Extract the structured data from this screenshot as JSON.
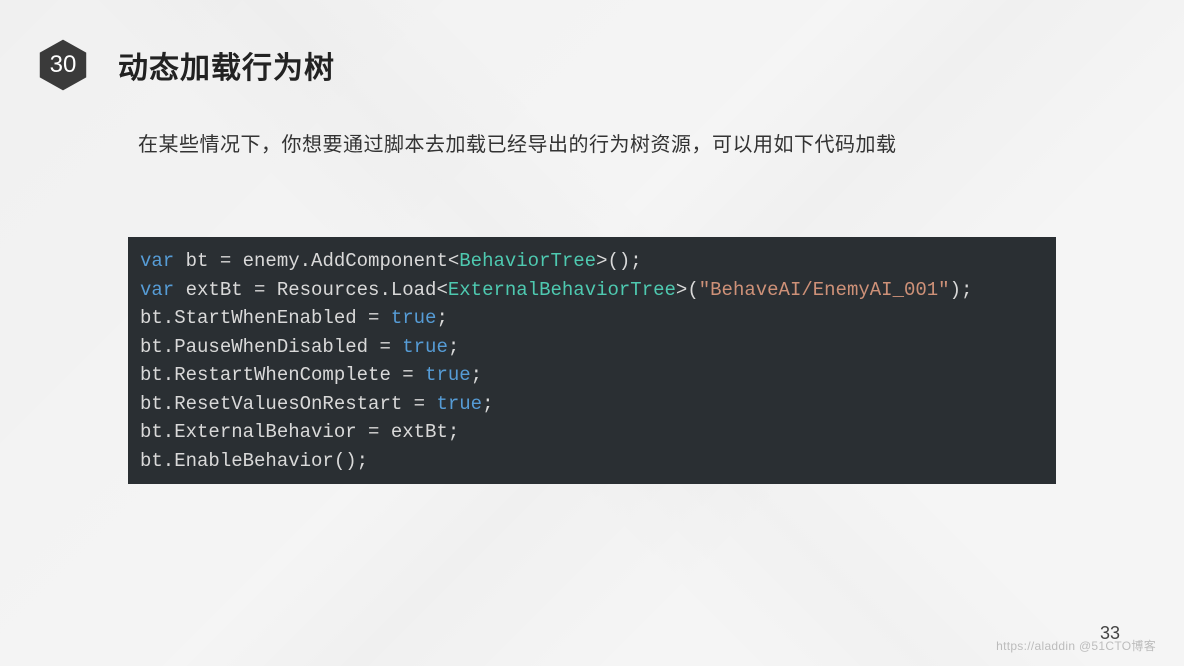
{
  "slide": {
    "number": "30",
    "title": "动态加载行为树",
    "description": "在某些情况下，你想要通过脚本去加载已经导出的行为树资源，可以用如下代码加载",
    "page_number": "33"
  },
  "code": {
    "lines": [
      {
        "tokens": [
          {
            "t": "kw",
            "v": "var"
          },
          {
            "t": "",
            "v": " bt = enemy.AddComponent<"
          },
          {
            "t": "type",
            "v": "BehaviorTree"
          },
          {
            "t": "",
            "v": ">();"
          }
        ]
      },
      {
        "tokens": [
          {
            "t": "kw",
            "v": "var"
          },
          {
            "t": "",
            "v": " extBt = Resources.Load<"
          },
          {
            "t": "type",
            "v": "ExternalBehaviorTree"
          },
          {
            "t": "",
            "v": ">("
          },
          {
            "t": "str",
            "v": "\"BehaveAI/EnemyAI_001\""
          },
          {
            "t": "",
            "v": ");"
          }
        ]
      },
      {
        "tokens": [
          {
            "t": "",
            "v": "bt.StartWhenEnabled = "
          },
          {
            "t": "kw",
            "v": "true"
          },
          {
            "t": "",
            "v": ";"
          }
        ]
      },
      {
        "tokens": [
          {
            "t": "",
            "v": "bt.PauseWhenDisabled = "
          },
          {
            "t": "kw",
            "v": "true"
          },
          {
            "t": "",
            "v": ";"
          }
        ]
      },
      {
        "tokens": [
          {
            "t": "",
            "v": "bt.RestartWhenComplete = "
          },
          {
            "t": "kw",
            "v": "true"
          },
          {
            "t": "",
            "v": ";"
          }
        ]
      },
      {
        "tokens": [
          {
            "t": "",
            "v": "bt.ResetValuesOnRestart = "
          },
          {
            "t": "kw",
            "v": "true"
          },
          {
            "t": "",
            "v": ";"
          }
        ]
      },
      {
        "tokens": [
          {
            "t": "",
            "v": "bt.ExternalBehavior = extBt;"
          }
        ]
      },
      {
        "tokens": [
          {
            "t": "",
            "v": "bt.EnableBehavior();"
          }
        ]
      }
    ]
  },
  "watermark": "https://aladdin @51CTO博客"
}
